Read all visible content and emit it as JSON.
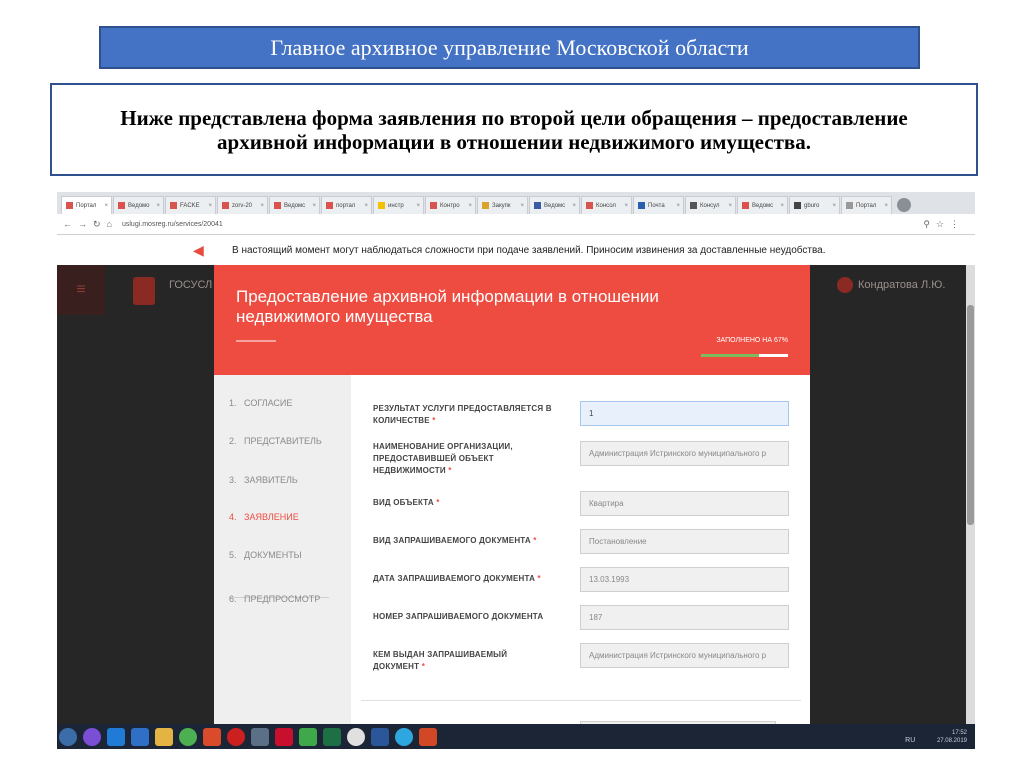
{
  "slide": {
    "title": "Главное архивное управление Московской области",
    "subtitle": "Ниже представлена форма заявления по второй цели обращения – предоставление архивной информации в отношении недвижимого имущества."
  },
  "browser": {
    "tabs": [
      "Портал",
      "Ведомо",
      "FACKE",
      "zorv-20",
      "Ведомс",
      "портал",
      "инстр",
      "Контро",
      "Закупк",
      "Ведомс",
      "Консол",
      "Почта",
      "Консул",
      "Ведомс",
      "gburo",
      "Портал"
    ],
    "url": "uslugi.mosreg.ru/services/20041",
    "notice": "В настоящий момент могут наблюдаться сложности при подаче заявлений. Приносим извинения за доставленные неудобства."
  },
  "portal": {
    "logo_text": "ГОСУСЛ",
    "user_name": "Кондратова Л.Ю."
  },
  "modal": {
    "title": "Предоставление архивной информации в отношении недвижимого имущества",
    "progress_label": "ЗАПОЛНЕНО НА 67%",
    "progress_fraction": 0.67,
    "steps": [
      {
        "num": "1.",
        "label": "СОГЛАСИЕ",
        "active": false
      },
      {
        "num": "2.",
        "label": "ПРЕДСТАВИТЕЛЬ",
        "active": false
      },
      {
        "num": "3.",
        "label": "ЗАЯВИТЕЛЬ",
        "active": false
      },
      {
        "num": "4.",
        "label": "ЗАЯВЛЕНИЕ",
        "active": true
      },
      {
        "num": "5.",
        "label": "ДОКУМЕНТЫ",
        "active": false
      },
      {
        "num": "6.",
        "label": "ПРЕДПРОСМОТР",
        "active": false
      }
    ],
    "fields": [
      {
        "label": "РЕЗУЛЬТАТ УСЛУГИ ПРЕДОСТАВЛЯЕТСЯ В КОЛИЧЕСТВЕ",
        "required": true,
        "value": "1"
      },
      {
        "label": "НАИМЕНОВАНИЕ ОРГАНИЗАЦИИ, ПРЕДОСТАВИВШЕЙ ОБЪЕКТ НЕДВИЖИМОСТИ",
        "required": true,
        "value": "Администрация Истринского муниципального р"
      },
      {
        "label": "ВИД ОБЪЕКТА",
        "required": true,
        "value": "Квартира"
      },
      {
        "label": "ВИД ЗАПРАШИВАЕМОГО ДОКУМЕНТА",
        "required": true,
        "value": "Постановление"
      },
      {
        "label": "ДАТА ЗАПРАШИВАЕМОГО ДОКУМЕНТА",
        "required": true,
        "value": "13.03.1993"
      },
      {
        "label": "НОМЕР ЗАПРАШИВАЕМОГО ДОКУМЕНТА",
        "required": false,
        "value": "187"
      },
      {
        "label": "КЕМ ВЫДАН ЗАПРАШИВАЕМЫЙ ДОКУМЕНТ",
        "required": true,
        "value": "Администрация Истринского муниципального р"
      }
    ]
  },
  "taskbar": {
    "lang": "RU",
    "time": "17:52",
    "date": "27.08.2019"
  },
  "colors": {
    "accent": "#ef4c41",
    "slide_blue": "#4472c4",
    "progress": "#7ebb5b"
  }
}
